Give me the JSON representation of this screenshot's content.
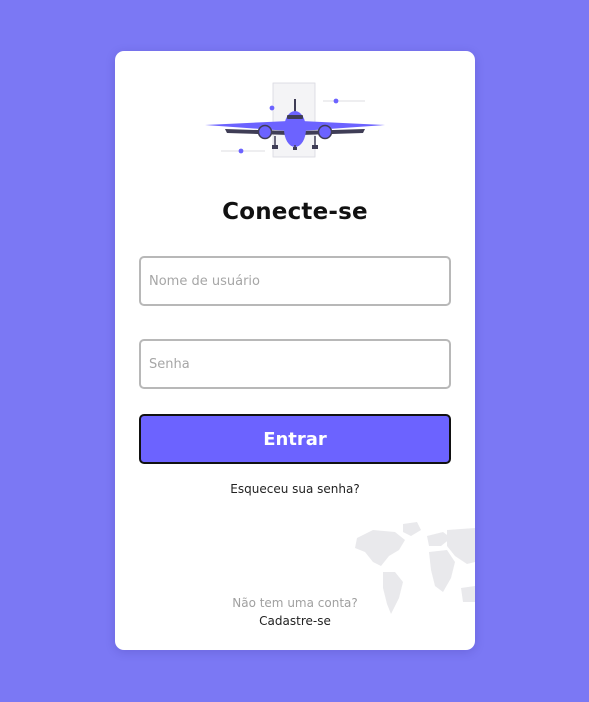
{
  "login": {
    "title": "Conecte-se",
    "username_placeholder": "Nome de usuário",
    "password_placeholder": "Senha",
    "submit_label": "Entrar",
    "forgot_password": "Esqueceu sua senha?",
    "no_account": "Não tem uma conta?",
    "signup_link": "Cadastre-se"
  },
  "colors": {
    "background": "#7b78f4",
    "card": "#ffffff",
    "accent": "#6c63ff",
    "input_border": "#b8b8b8"
  },
  "icons": {
    "illustration": "airplane-illustration",
    "decoration": "world-map-illustration"
  }
}
